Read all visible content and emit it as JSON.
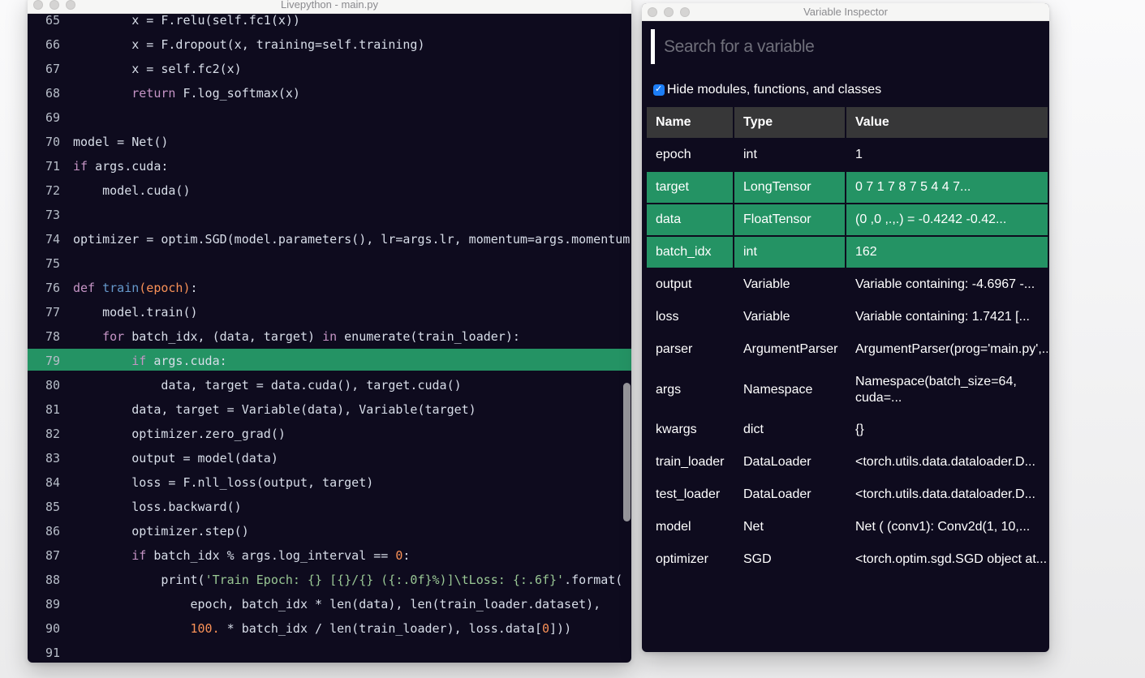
{
  "colors": {
    "desktop_top": "#fafafb",
    "desktop_bottom": "#ebebec",
    "window_background": "#0e0b1e",
    "highlight_green": "#249364",
    "titlebar": "#f6f6f5",
    "table_header": "#373738",
    "checkbox_blue": "#1d7ef6",
    "keyword": "#c594c5",
    "function_name": "#6699cc",
    "number": "#f99157",
    "string": "#99c794",
    "code_text": "#d8dee9"
  },
  "editor_window": {
    "title": "Livepython - main.py",
    "highlight_line": 79,
    "lines": [
      {
        "no": 65,
        "hl": false,
        "tokens": [
          [
            "p",
            "        x = F.relu(self.fc1(x))"
          ]
        ]
      },
      {
        "no": 66,
        "hl": false,
        "tokens": [
          [
            "p",
            "        x = F.dropout(x, training=self.training)"
          ]
        ]
      },
      {
        "no": 67,
        "hl": false,
        "tokens": [
          [
            "p",
            "        x = self.fc2(x)"
          ]
        ]
      },
      {
        "no": 68,
        "hl": false,
        "tokens": [
          [
            "p",
            "        "
          ],
          [
            "k",
            "return"
          ],
          [
            "p",
            " F.log_softmax(x)"
          ]
        ]
      },
      {
        "no": 69,
        "hl": false,
        "tokens": []
      },
      {
        "no": 70,
        "hl": false,
        "tokens": [
          [
            "p",
            "model = Net()"
          ]
        ]
      },
      {
        "no": 71,
        "hl": false,
        "tokens": [
          [
            "k",
            "if"
          ],
          [
            "p",
            " args.cuda:"
          ]
        ]
      },
      {
        "no": 72,
        "hl": false,
        "tokens": [
          [
            "p",
            "    model.cuda()"
          ]
        ]
      },
      {
        "no": 73,
        "hl": false,
        "tokens": []
      },
      {
        "no": 74,
        "hl": false,
        "tokens": [
          [
            "p",
            "optimizer = optim.SGD(model.parameters(), lr=args.lr, momentum=args.momentum)"
          ]
        ]
      },
      {
        "no": 75,
        "hl": false,
        "tokens": []
      },
      {
        "no": 76,
        "hl": false,
        "tokens": [
          [
            "k",
            "def"
          ],
          [
            "p",
            " "
          ],
          [
            "f",
            "train"
          ],
          [
            "o",
            "(epoch)"
          ],
          [
            "p",
            ":"
          ]
        ]
      },
      {
        "no": 77,
        "hl": false,
        "tokens": [
          [
            "p",
            "    model.train()"
          ]
        ]
      },
      {
        "no": 78,
        "hl": false,
        "tokens": [
          [
            "p",
            "    "
          ],
          [
            "k",
            "for"
          ],
          [
            "p",
            " batch_idx, (data, target) "
          ],
          [
            "k",
            "in"
          ],
          [
            "p",
            " enumerate(train_loader):"
          ]
        ]
      },
      {
        "no": 79,
        "hl": true,
        "tokens": [
          [
            "p",
            "        "
          ],
          [
            "k",
            "if"
          ],
          [
            "p",
            " args.cuda:"
          ]
        ]
      },
      {
        "no": 80,
        "hl": false,
        "tokens": [
          [
            "p",
            "            data, target = data.cuda(), target.cuda()"
          ]
        ]
      },
      {
        "no": 81,
        "hl": false,
        "tokens": [
          [
            "p",
            "        data, target = Variable(data), Variable(target)"
          ]
        ]
      },
      {
        "no": 82,
        "hl": false,
        "tokens": [
          [
            "p",
            "        optimizer.zero_grad()"
          ]
        ]
      },
      {
        "no": 83,
        "hl": false,
        "tokens": [
          [
            "p",
            "        output = model(data)"
          ]
        ]
      },
      {
        "no": 84,
        "hl": false,
        "tokens": [
          [
            "p",
            "        loss = F.nll_loss(output, target)"
          ]
        ]
      },
      {
        "no": 85,
        "hl": false,
        "tokens": [
          [
            "p",
            "        loss.backward()"
          ]
        ]
      },
      {
        "no": 86,
        "hl": false,
        "tokens": [
          [
            "p",
            "        optimizer.step()"
          ]
        ]
      },
      {
        "no": 87,
        "hl": false,
        "tokens": [
          [
            "p",
            "        "
          ],
          [
            "k",
            "if"
          ],
          [
            "p",
            " batch_idx % args.log_interval == "
          ],
          [
            "o",
            "0"
          ],
          [
            "p",
            ":"
          ]
        ]
      },
      {
        "no": 88,
        "hl": false,
        "tokens": [
          [
            "p",
            "            print("
          ],
          [
            "s",
            "'Train Epoch: {} [{}/{} ({:.0f}%)]\\tLoss: {:.6f}'"
          ],
          [
            "p",
            ".format("
          ]
        ]
      },
      {
        "no": 89,
        "hl": false,
        "tokens": [
          [
            "p",
            "                epoch, batch_idx * len(data), len(train_loader.dataset),"
          ]
        ]
      },
      {
        "no": 90,
        "hl": false,
        "tokens": [
          [
            "p",
            "                "
          ],
          [
            "o",
            "100."
          ],
          [
            "p",
            " * batch_idx / len(train_loader), loss.data["
          ],
          [
            "o",
            "0"
          ],
          [
            "p",
            "]))"
          ]
        ]
      },
      {
        "no": 91,
        "hl": false,
        "tokens": []
      }
    ]
  },
  "inspector_window": {
    "title": "Variable Inspector",
    "search": {
      "placeholder": "Search for a variable"
    },
    "filter_checkbox": {
      "label": "Hide modules, functions, and classes",
      "checked": true
    },
    "table": {
      "columns": [
        "Name",
        "Type",
        "Value"
      ],
      "rows": [
        {
          "name": "epoch",
          "type": "int",
          "value": "1",
          "highlight": false
        },
        {
          "name": "target",
          "type": "LongTensor",
          "value": "0 7 1 7 8 7 5 4 4 7...",
          "highlight": true
        },
        {
          "name": "data",
          "type": "FloatTensor",
          "value": "(0 ,0 ,.,.) = -0.4242 -0.42...",
          "highlight": true
        },
        {
          "name": "batch_idx",
          "type": "int",
          "value": "162",
          "highlight": true
        },
        {
          "name": "output",
          "type": "Variable",
          "value": "Variable containing: -4.6967 -...",
          "highlight": false
        },
        {
          "name": "loss",
          "type": "Variable",
          "value": "Variable containing: 1.7421 [...",
          "highlight": false
        },
        {
          "name": "parser",
          "type": "ArgumentParser",
          "value": "ArgumentParser(prog='main.py',...",
          "highlight": false
        },
        {
          "name": "args",
          "type": "Namespace",
          "value": "Namespace(batch_size=64, cuda=...",
          "highlight": false,
          "wrap": true
        },
        {
          "name": "kwargs",
          "type": "dict",
          "value": "{}",
          "highlight": false
        },
        {
          "name": "train_loader",
          "type": "DataLoader",
          "value": "<torch.utils.data.dataloader.D...",
          "highlight": false
        },
        {
          "name": "test_loader",
          "type": "DataLoader",
          "value": "<torch.utils.data.dataloader.D...",
          "highlight": false
        },
        {
          "name": "model",
          "type": "Net",
          "value": "Net ( (conv1): Conv2d(1, 10,...",
          "highlight": false
        },
        {
          "name": "optimizer",
          "type": "SGD",
          "value": "<torch.optim.sgd.SGD object at...",
          "highlight": false
        }
      ]
    }
  }
}
